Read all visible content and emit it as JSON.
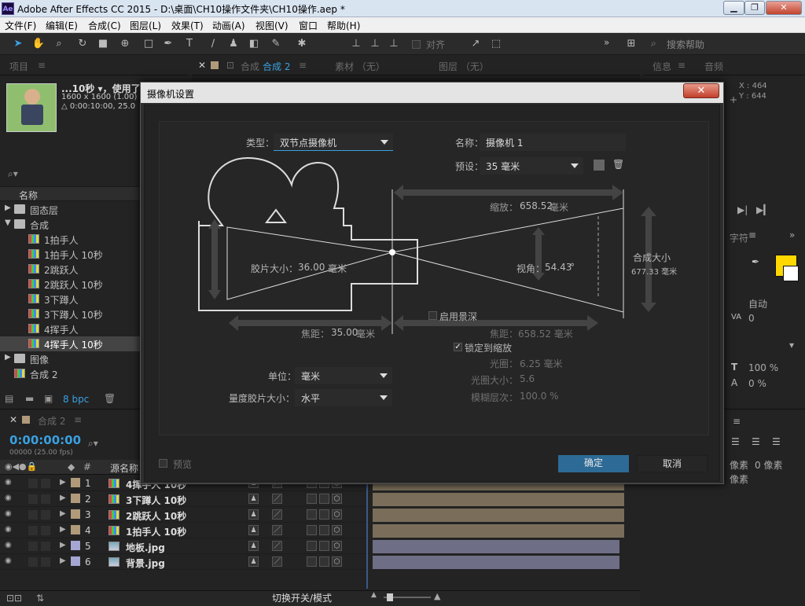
{
  "window": {
    "app_logo": "Ae",
    "title": "Adobe After Effects CC 2015 - D:\\桌面\\CH10操作文件夹\\CH10操作.aep *",
    "minimize": "▁",
    "restore": "❐",
    "close": "✕"
  },
  "menu": [
    "文件(F)",
    "编辑(E)",
    "合成(C)",
    "图层(L)",
    "效果(T)",
    "动画(A)",
    "视图(V)",
    "窗口",
    "帮助(H)"
  ],
  "toolbar": {
    "align_label": "对齐",
    "search_placeholder": "搜索帮助",
    "more": "»"
  },
  "project": {
    "tab": "项目",
    "preview_name": "...10秒 ▾，使用了",
    "preview_size": "1600 x 1600 (1.00)",
    "preview_time": "△ 0:00:10:00, 25.0",
    "search_icon": "⌕▾",
    "column_name": "名称",
    "items": [
      {
        "label": "固态层",
        "type": "folder",
        "tw": "▶"
      },
      {
        "label": "合成",
        "type": "folder",
        "tw": "▼"
      },
      {
        "label": "1拍手人",
        "type": "comp"
      },
      {
        "label": "1拍手人 10秒",
        "type": "comp"
      },
      {
        "label": "2跳跃人",
        "type": "comp"
      },
      {
        "label": "2跳跃人 10秒",
        "type": "comp"
      },
      {
        "label": "3下蹲人",
        "type": "comp"
      },
      {
        "label": "3下蹲人 10秒",
        "type": "comp"
      },
      {
        "label": "4挥手人",
        "type": "comp"
      },
      {
        "label": "4挥手人 10秒",
        "type": "comp",
        "selected": true
      },
      {
        "label": "图像",
        "type": "folder",
        "tw": "▶"
      },
      {
        "label": "合成 2",
        "type": "comp"
      }
    ],
    "bpc": "8 bpc"
  },
  "viewer_tabs": {
    "close": "✕",
    "lock": "🔒",
    "comp_prefix": "合成",
    "comp_name": "合成 2",
    "menu": "≡",
    "footage": "素材 （无）",
    "layer": "图层 （无）"
  },
  "info": {
    "tab1": "信息",
    "menu": "≡",
    "tab2": "音频",
    "x": "X : 464",
    "y": "Y : 644",
    "crosshair": "+"
  },
  "right_panel": {
    "char_tab": "字符",
    "auto": "自动",
    "tracking": "0",
    "vscale": "100 %",
    "baseline": "0 %",
    "px_left": "像素",
    "px_right": "0 像素",
    "px_left2": "像素",
    "fill_color": "#ffd800"
  },
  "timeline": {
    "tab_comp": "合成 2",
    "timecode": "0:00:00:00",
    "frames": "00000 (25.00 fps)",
    "col_source": "源名称",
    "bottom_label": "切换开关/模式",
    "layers": [
      {
        "num": "1",
        "name": "4挥手人 10秒",
        "color": "#b09a7a",
        "bar": "#7a6e5a",
        "type": "comp"
      },
      {
        "num": "2",
        "name": "3下蹲人 10秒",
        "color": "#b09a7a",
        "bar": "#7a6e5a",
        "type": "comp"
      },
      {
        "num": "3",
        "name": "2跳跃人 10秒",
        "color": "#b09a7a",
        "bar": "#7a6e5a",
        "type": "comp"
      },
      {
        "num": "4",
        "name": "1拍手人 10秒",
        "color": "#b09a7a",
        "bar": "#7a6e5a",
        "type": "comp"
      },
      {
        "num": "5",
        "name": "地板.jpg",
        "color": "#a6a6d2",
        "bar": "#6e6e86",
        "type": "image"
      },
      {
        "num": "6",
        "name": "背景.jpg",
        "color": "#a6a6d2",
        "bar": "#6e6e86",
        "type": "image"
      }
    ]
  },
  "dialog": {
    "title": "摄像机设置",
    "close": "✕",
    "type_label": "类型：",
    "type_value": "双节点摄像机",
    "name_label": "名称：",
    "name_value": "摄像机 1",
    "preset_label": "预设：",
    "preset_value": "35 毫米",
    "zoom_label": "缩放：",
    "zoom_value": "658.52",
    "unit_mm": "毫米",
    "film_label": "胶片大小：",
    "film_value": "36.00",
    "fov_label": "视角：",
    "fov_value": "54.43",
    "fov_unit": "°",
    "comp_label": "合成大小",
    "comp_value": "677.33 毫米",
    "focal_label": "焦距：",
    "focal_value": "35.00",
    "focus_dist_label": "焦距：",
    "focus_dist_value": "658.52 毫米",
    "dof_label": "启用景深",
    "lock_label": "锁定到缩放",
    "aperture_label": "光圈：",
    "aperture_value": "6.25 毫米",
    "fstop_label": "光圈大小：",
    "fstop_value": "5.6",
    "blur_label": "模糊层次：",
    "blur_value": "100.0 %",
    "units_label": "单位：",
    "units_value": "毫米",
    "measure_label": "量度胶片大小：",
    "measure_value": "水平",
    "preview_label": "预览",
    "ok": "确定",
    "cancel": "取消",
    "check_mark": "✓"
  }
}
